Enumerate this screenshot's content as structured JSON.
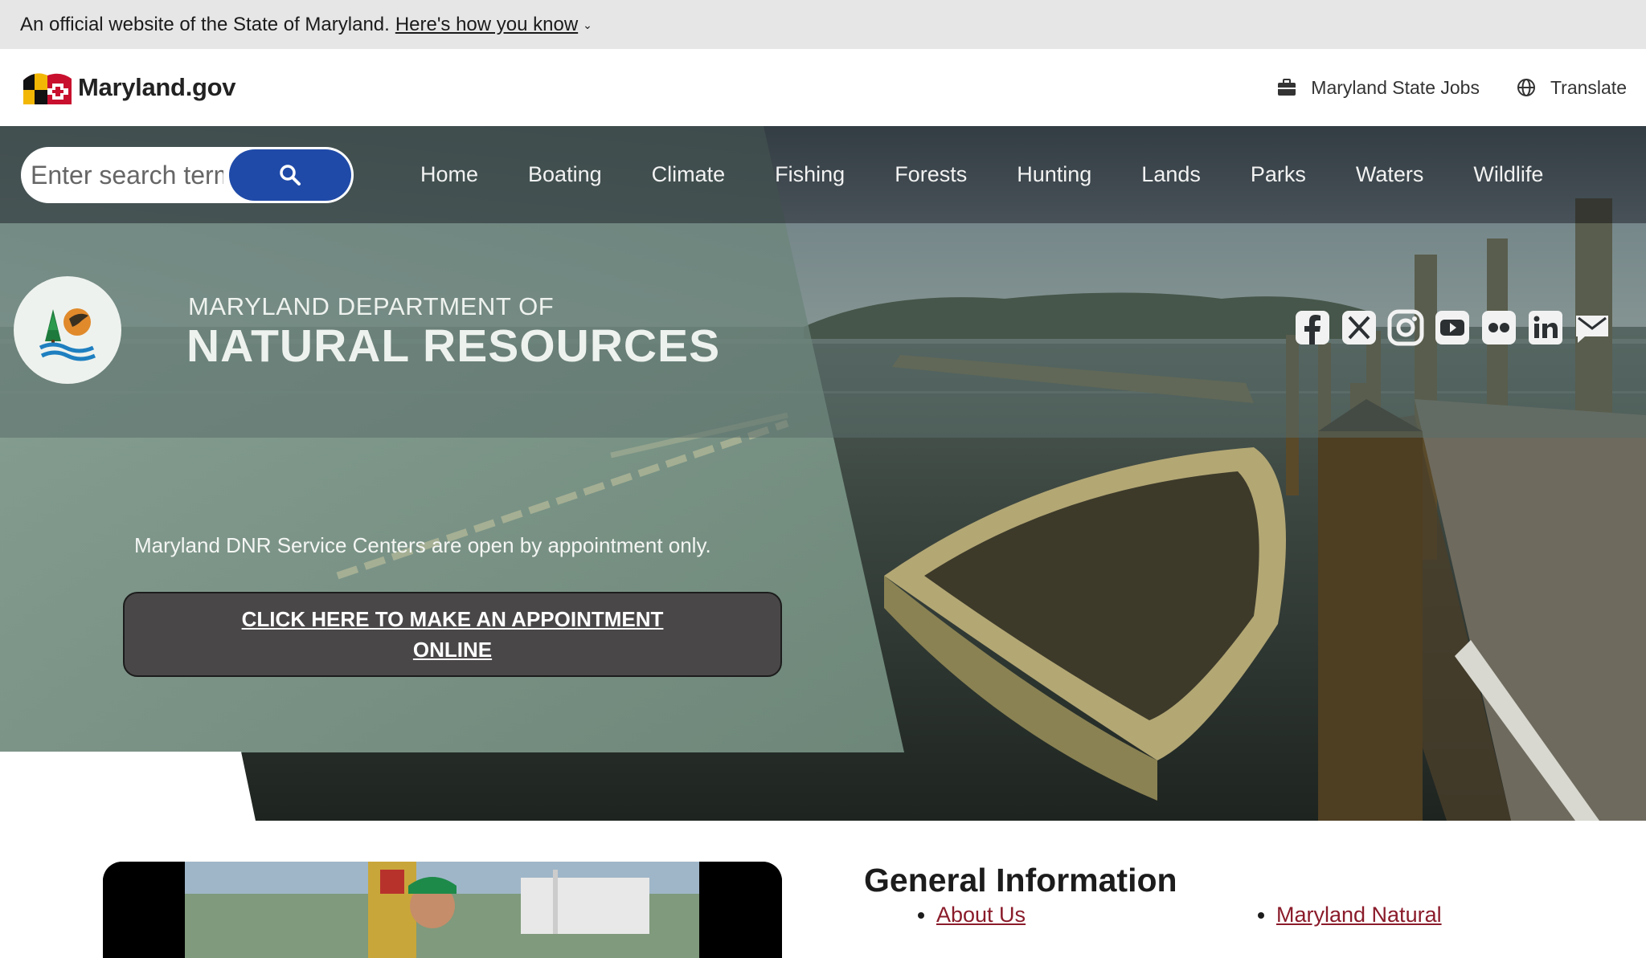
{
  "official_bar": {
    "text": "An official website of the State of Maryland.",
    "link": "Here's how you know",
    "chevron": "⌄"
  },
  "header": {
    "brand": "Maryland.gov",
    "jobs": "Maryland State Jobs",
    "translate": "Translate"
  },
  "search": {
    "placeholder": "Enter search terms"
  },
  "nav": {
    "items": [
      "Home",
      "Boating",
      "Climate",
      "Fishing",
      "Forests",
      "Hunting",
      "Lands",
      "Parks",
      "Waters",
      "Wildlife"
    ]
  },
  "dnr": {
    "subtitle": "MARYLAND DEPARTMENT OF",
    "title": "NATURAL RESOURCES"
  },
  "social": {
    "icons": [
      "facebook-icon",
      "x-icon",
      "instagram-icon",
      "youtube-icon",
      "flickr-icon",
      "linkedin-icon",
      "email-icon"
    ]
  },
  "notice": {
    "text": "Maryland DNR Service Centers are open by appointment only.",
    "button": "CLICK HERE TO MAKE AN APPOINTMENT ONLINE"
  },
  "general": {
    "title": "General Information",
    "col1": [
      "About Us"
    ],
    "col2": [
      "Maryland Natural"
    ]
  },
  "colors": {
    "accent_blue": "#1f4aa8",
    "link_red": "#8a1b2a",
    "button_gray": "#4a4748"
  }
}
